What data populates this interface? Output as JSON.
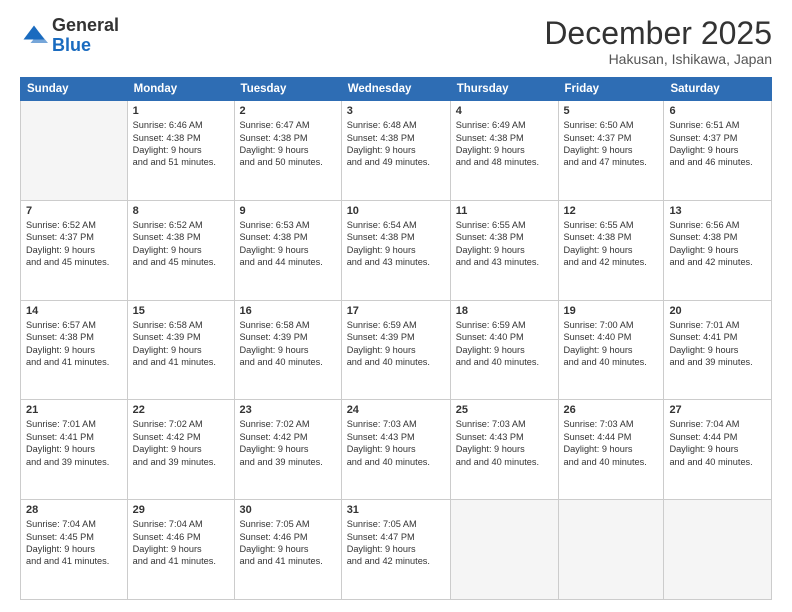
{
  "header": {
    "logo_general": "General",
    "logo_blue": "Blue",
    "title": "December 2025",
    "subtitle": "Hakusan, Ishikawa, Japan"
  },
  "days_header": [
    "Sunday",
    "Monday",
    "Tuesday",
    "Wednesday",
    "Thursday",
    "Friday",
    "Saturday"
  ],
  "weeks": [
    [
      {
        "day": "",
        "sunrise": "",
        "sunset": "",
        "daylight": ""
      },
      {
        "day": "1",
        "sunrise": "Sunrise: 6:46 AM",
        "sunset": "Sunset: 4:38 PM",
        "daylight": "Daylight: 9 hours and 51 minutes."
      },
      {
        "day": "2",
        "sunrise": "Sunrise: 6:47 AM",
        "sunset": "Sunset: 4:38 PM",
        "daylight": "Daylight: 9 hours and 50 minutes."
      },
      {
        "day": "3",
        "sunrise": "Sunrise: 6:48 AM",
        "sunset": "Sunset: 4:38 PM",
        "daylight": "Daylight: 9 hours and 49 minutes."
      },
      {
        "day": "4",
        "sunrise": "Sunrise: 6:49 AM",
        "sunset": "Sunset: 4:38 PM",
        "daylight": "Daylight: 9 hours and 48 minutes."
      },
      {
        "day": "5",
        "sunrise": "Sunrise: 6:50 AM",
        "sunset": "Sunset: 4:37 PM",
        "daylight": "Daylight: 9 hours and 47 minutes."
      },
      {
        "day": "6",
        "sunrise": "Sunrise: 6:51 AM",
        "sunset": "Sunset: 4:37 PM",
        "daylight": "Daylight: 9 hours and 46 minutes."
      }
    ],
    [
      {
        "day": "7",
        "sunrise": "Sunrise: 6:52 AM",
        "sunset": "Sunset: 4:37 PM",
        "daylight": "Daylight: 9 hours and 45 minutes."
      },
      {
        "day": "8",
        "sunrise": "Sunrise: 6:52 AM",
        "sunset": "Sunset: 4:38 PM",
        "daylight": "Daylight: 9 hours and 45 minutes."
      },
      {
        "day": "9",
        "sunrise": "Sunrise: 6:53 AM",
        "sunset": "Sunset: 4:38 PM",
        "daylight": "Daylight: 9 hours and 44 minutes."
      },
      {
        "day": "10",
        "sunrise": "Sunrise: 6:54 AM",
        "sunset": "Sunset: 4:38 PM",
        "daylight": "Daylight: 9 hours and 43 minutes."
      },
      {
        "day": "11",
        "sunrise": "Sunrise: 6:55 AM",
        "sunset": "Sunset: 4:38 PM",
        "daylight": "Daylight: 9 hours and 43 minutes."
      },
      {
        "day": "12",
        "sunrise": "Sunrise: 6:55 AM",
        "sunset": "Sunset: 4:38 PM",
        "daylight": "Daylight: 9 hours and 42 minutes."
      },
      {
        "day": "13",
        "sunrise": "Sunrise: 6:56 AM",
        "sunset": "Sunset: 4:38 PM",
        "daylight": "Daylight: 9 hours and 42 minutes."
      }
    ],
    [
      {
        "day": "14",
        "sunrise": "Sunrise: 6:57 AM",
        "sunset": "Sunset: 4:38 PM",
        "daylight": "Daylight: 9 hours and 41 minutes."
      },
      {
        "day": "15",
        "sunrise": "Sunrise: 6:58 AM",
        "sunset": "Sunset: 4:39 PM",
        "daylight": "Daylight: 9 hours and 41 minutes."
      },
      {
        "day": "16",
        "sunrise": "Sunrise: 6:58 AM",
        "sunset": "Sunset: 4:39 PM",
        "daylight": "Daylight: 9 hours and 40 minutes."
      },
      {
        "day": "17",
        "sunrise": "Sunrise: 6:59 AM",
        "sunset": "Sunset: 4:39 PM",
        "daylight": "Daylight: 9 hours and 40 minutes."
      },
      {
        "day": "18",
        "sunrise": "Sunrise: 6:59 AM",
        "sunset": "Sunset: 4:40 PM",
        "daylight": "Daylight: 9 hours and 40 minutes."
      },
      {
        "day": "19",
        "sunrise": "Sunrise: 7:00 AM",
        "sunset": "Sunset: 4:40 PM",
        "daylight": "Daylight: 9 hours and 40 minutes."
      },
      {
        "day": "20",
        "sunrise": "Sunrise: 7:01 AM",
        "sunset": "Sunset: 4:41 PM",
        "daylight": "Daylight: 9 hours and 39 minutes."
      }
    ],
    [
      {
        "day": "21",
        "sunrise": "Sunrise: 7:01 AM",
        "sunset": "Sunset: 4:41 PM",
        "daylight": "Daylight: 9 hours and 39 minutes."
      },
      {
        "day": "22",
        "sunrise": "Sunrise: 7:02 AM",
        "sunset": "Sunset: 4:42 PM",
        "daylight": "Daylight: 9 hours and 39 minutes."
      },
      {
        "day": "23",
        "sunrise": "Sunrise: 7:02 AM",
        "sunset": "Sunset: 4:42 PM",
        "daylight": "Daylight: 9 hours and 39 minutes."
      },
      {
        "day": "24",
        "sunrise": "Sunrise: 7:03 AM",
        "sunset": "Sunset: 4:43 PM",
        "daylight": "Daylight: 9 hours and 40 minutes."
      },
      {
        "day": "25",
        "sunrise": "Sunrise: 7:03 AM",
        "sunset": "Sunset: 4:43 PM",
        "daylight": "Daylight: 9 hours and 40 minutes."
      },
      {
        "day": "26",
        "sunrise": "Sunrise: 7:03 AM",
        "sunset": "Sunset: 4:44 PM",
        "daylight": "Daylight: 9 hours and 40 minutes."
      },
      {
        "day": "27",
        "sunrise": "Sunrise: 7:04 AM",
        "sunset": "Sunset: 4:44 PM",
        "daylight": "Daylight: 9 hours and 40 minutes."
      }
    ],
    [
      {
        "day": "28",
        "sunrise": "Sunrise: 7:04 AM",
        "sunset": "Sunset: 4:45 PM",
        "daylight": "Daylight: 9 hours and 41 minutes."
      },
      {
        "day": "29",
        "sunrise": "Sunrise: 7:04 AM",
        "sunset": "Sunset: 4:46 PM",
        "daylight": "Daylight: 9 hours and 41 minutes."
      },
      {
        "day": "30",
        "sunrise": "Sunrise: 7:05 AM",
        "sunset": "Sunset: 4:46 PM",
        "daylight": "Daylight: 9 hours and 41 minutes."
      },
      {
        "day": "31",
        "sunrise": "Sunrise: 7:05 AM",
        "sunset": "Sunset: 4:47 PM",
        "daylight": "Daylight: 9 hours and 42 minutes."
      },
      {
        "day": "",
        "sunrise": "",
        "sunset": "",
        "daylight": ""
      },
      {
        "day": "",
        "sunrise": "",
        "sunset": "",
        "daylight": ""
      },
      {
        "day": "",
        "sunrise": "",
        "sunset": "",
        "daylight": ""
      }
    ]
  ]
}
